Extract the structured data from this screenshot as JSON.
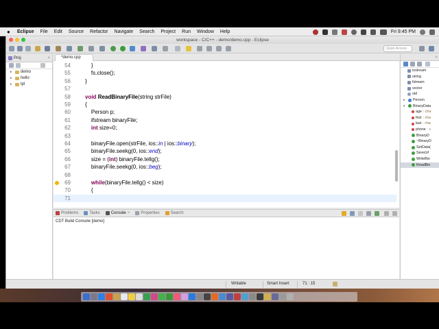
{
  "menubar": {
    "app": "Eclipse",
    "menus": [
      "File",
      "Edit",
      "Source",
      "Refactor",
      "Navigate",
      "Search",
      "Project",
      "Run",
      "Window",
      "Help"
    ],
    "clock": "Fri 9:45 PM"
  },
  "window": {
    "title": "workspace - C/C++ - demo/demo.cpp - Eclipse",
    "quick_access_placeholder": "Quick Access"
  },
  "explorer": {
    "tab_label": "Proj",
    "items": [
      {
        "name": "demo"
      },
      {
        "name": "hello"
      },
      {
        "name": "tpl"
      }
    ]
  },
  "editor": {
    "tab_label": "*demo.cpp",
    "lines": [
      {
        "n": "54",
        "text": "    }"
      },
      {
        "n": "55",
        "text": "    fs.close();"
      },
      {
        "n": "56",
        "text": "}"
      },
      {
        "n": "57",
        "text": ""
      },
      {
        "n": "58",
        "text": "void ReadBinaryFile(string strFile)"
      },
      {
        "n": "59",
        "text": "{"
      },
      {
        "n": "60",
        "text": "    Person p;"
      },
      {
        "n": "61",
        "text": "    ifstream binaryFile;"
      },
      {
        "n": "62",
        "text": "    int size=0;"
      },
      {
        "n": "63",
        "text": ""
      },
      {
        "n": "64",
        "text": "    binaryFile.open(strFile, ios::in | ios::binary);"
      },
      {
        "n": "65",
        "text": "    binaryFile.seekg(0, ios::end);"
      },
      {
        "n": "66",
        "text": "    size = (int) binaryFile.tellg();"
      },
      {
        "n": "67",
        "text": "    binaryFile.seekg(0, ios::beg);"
      },
      {
        "n": "68",
        "text": ""
      },
      {
        "n": "69",
        "text": "    while(binaryFile.tellg() < size)"
      },
      {
        "n": "70",
        "text": "    {"
      },
      {
        "n": "71",
        "text": ""
      }
    ]
  },
  "outline": {
    "items": [
      {
        "label": "iostream",
        "type": ""
      },
      {
        "label": "string",
        "type": ""
      },
      {
        "label": "fstream",
        "type": ""
      },
      {
        "label": "vector",
        "type": ""
      },
      {
        "label": "std",
        "type": ""
      },
      {
        "label": "Person",
        "type": ""
      },
      {
        "label": "BinaryData",
        "type": ""
      },
      {
        "label": "age",
        "type": ": cha"
      },
      {
        "label": "first",
        "type": ": cha"
      },
      {
        "label": "last",
        "type": ": cha"
      },
      {
        "label": "phone",
        "type": ": c"
      },
      {
        "label": "BinaryD",
        "type": ""
      },
      {
        "label": "~BinaryD",
        "type": ""
      },
      {
        "label": "SetData(",
        "type": ""
      },
      {
        "label": "Save(sf",
        "type": ""
      },
      {
        "label": "WriteBin",
        "type": ""
      },
      {
        "label": "ReadBin",
        "type": ""
      }
    ]
  },
  "console": {
    "tabs": [
      "Problems",
      "Tasks",
      "Console",
      "Properties",
      "Search"
    ],
    "active_tab": "Console",
    "body": "CDT Build Console [demo]"
  },
  "statusbar": {
    "mode": "Writable",
    "insert": "Smart Insert",
    "position": "71 : 15"
  },
  "colors": {
    "keyword": "#7f0055",
    "italic_const": "#0000c0",
    "current_line": "#e8f2fe"
  }
}
